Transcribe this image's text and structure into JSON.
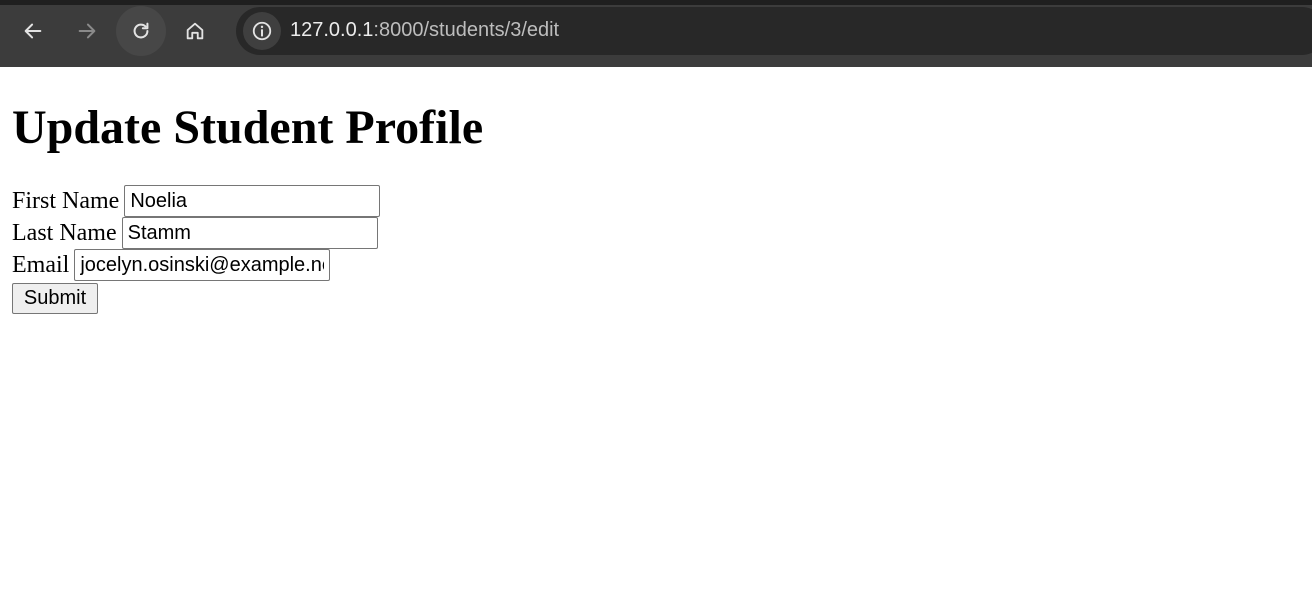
{
  "browser": {
    "url_host": "127.0.0.1",
    "url_rest": ":8000/students/3/edit",
    "icons": {
      "back": "arrow-left-icon",
      "forward": "arrow-right-icon",
      "reload": "reload-icon",
      "home": "home-icon",
      "site_info": "info-icon"
    }
  },
  "page": {
    "title": "Update Student Profile",
    "form": {
      "first_name_label": "First Name",
      "first_name_value": "Noelia",
      "last_name_label": "Last Name",
      "last_name_value": "Stamm",
      "email_label": "Email",
      "email_value": "jocelyn.osinski@example.net",
      "submit_label": "Submit"
    }
  }
}
